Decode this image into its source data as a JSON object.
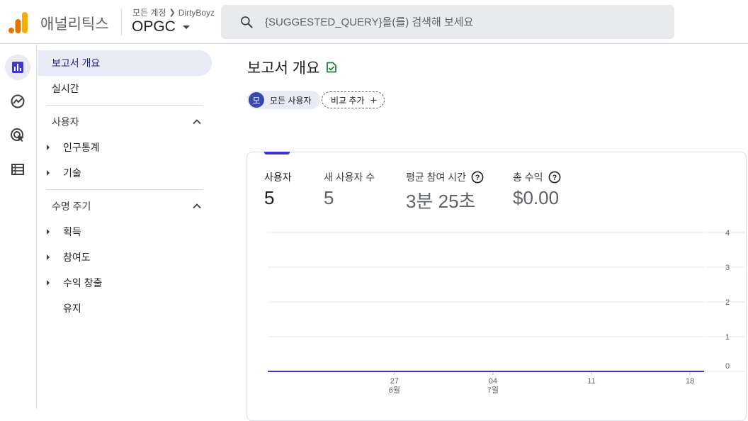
{
  "header": {
    "brand": "애널리틱스",
    "account_path": "모든 계정",
    "account_name": "DirtyBoyz",
    "property": "OPGC",
    "search_placeholder": "{SUGGESTED_QUERY}을(를) 검색해 보세요"
  },
  "rail": {
    "icons": [
      "bar-chart-icon",
      "explore-icon",
      "ads-target-icon",
      "list-icon"
    ]
  },
  "nav": {
    "overview": "보고서 개요",
    "realtime": "실시간",
    "user_section": "사용자",
    "user_items": [
      "인구통계",
      "기술"
    ],
    "lifecycle_section": "수명 주기",
    "lifecycle_items": [
      "획득",
      "참여도",
      "수익 창출"
    ],
    "retention": "유지"
  },
  "main": {
    "title": "보고서 개요",
    "segment_avatar": "모",
    "segment_label": "모든 사용자",
    "compare_label": "비교 추가"
  },
  "metrics": [
    {
      "label": "사용자",
      "value": "5"
    },
    {
      "label": "새 사용자 수",
      "value": "5"
    },
    {
      "label": "평균 참여 시간",
      "value": "3분 25초"
    },
    {
      "label": "총 수익",
      "value": "$0.00"
    }
  ],
  "colors": {
    "accent": "#3f35cf",
    "nav_active_bg": "#e8eaf6",
    "search_bg": "#e8eaed"
  },
  "chart_data": {
    "type": "line",
    "x_ticks": [
      {
        "day": "27",
        "month": "6월",
        "index": 9
      },
      {
        "day": "04",
        "month": "7월",
        "index": 16
      },
      {
        "day": "11",
        "month": "",
        "index": 23
      },
      {
        "day": "18",
        "month": "",
        "index": 30
      }
    ],
    "yticks": [
      0,
      1,
      2,
      3,
      4
    ],
    "ylim": [
      0,
      4
    ],
    "grid": true,
    "y_axis_side": "right",
    "series": [
      {
        "values": [
          0,
          0,
          0,
          0,
          0,
          0,
          0,
          0,
          0,
          0,
          0,
          0,
          0,
          0,
          0,
          0,
          0,
          0,
          0,
          0,
          0,
          0,
          0,
          0,
          0,
          0,
          0,
          0,
          0,
          0,
          0,
          0
        ]
      }
    ]
  }
}
